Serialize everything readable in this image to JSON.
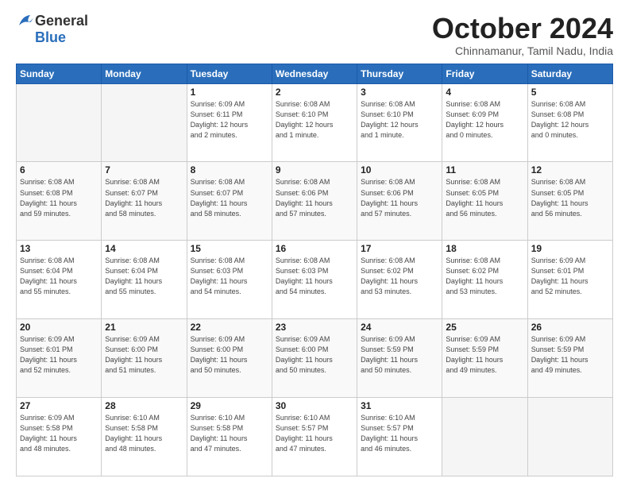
{
  "logo": {
    "line1": "General",
    "line2": "Blue"
  },
  "title": "October 2024",
  "subtitle": "Chinnamanur, Tamil Nadu, India",
  "weekdays": [
    "Sunday",
    "Monday",
    "Tuesday",
    "Wednesday",
    "Thursday",
    "Friday",
    "Saturday"
  ],
  "weeks": [
    [
      {
        "day": "",
        "info": ""
      },
      {
        "day": "",
        "info": ""
      },
      {
        "day": "1",
        "info": "Sunrise: 6:09 AM\nSunset: 6:11 PM\nDaylight: 12 hours\nand 2 minutes."
      },
      {
        "day": "2",
        "info": "Sunrise: 6:08 AM\nSunset: 6:10 PM\nDaylight: 12 hours\nand 1 minute."
      },
      {
        "day": "3",
        "info": "Sunrise: 6:08 AM\nSunset: 6:10 PM\nDaylight: 12 hours\nand 1 minute."
      },
      {
        "day": "4",
        "info": "Sunrise: 6:08 AM\nSunset: 6:09 PM\nDaylight: 12 hours\nand 0 minutes."
      },
      {
        "day": "5",
        "info": "Sunrise: 6:08 AM\nSunset: 6:08 PM\nDaylight: 12 hours\nand 0 minutes."
      }
    ],
    [
      {
        "day": "6",
        "info": "Sunrise: 6:08 AM\nSunset: 6:08 PM\nDaylight: 11 hours\nand 59 minutes."
      },
      {
        "day": "7",
        "info": "Sunrise: 6:08 AM\nSunset: 6:07 PM\nDaylight: 11 hours\nand 58 minutes."
      },
      {
        "day": "8",
        "info": "Sunrise: 6:08 AM\nSunset: 6:07 PM\nDaylight: 11 hours\nand 58 minutes."
      },
      {
        "day": "9",
        "info": "Sunrise: 6:08 AM\nSunset: 6:06 PM\nDaylight: 11 hours\nand 57 minutes."
      },
      {
        "day": "10",
        "info": "Sunrise: 6:08 AM\nSunset: 6:06 PM\nDaylight: 11 hours\nand 57 minutes."
      },
      {
        "day": "11",
        "info": "Sunrise: 6:08 AM\nSunset: 6:05 PM\nDaylight: 11 hours\nand 56 minutes."
      },
      {
        "day": "12",
        "info": "Sunrise: 6:08 AM\nSunset: 6:05 PM\nDaylight: 11 hours\nand 56 minutes."
      }
    ],
    [
      {
        "day": "13",
        "info": "Sunrise: 6:08 AM\nSunset: 6:04 PM\nDaylight: 11 hours\nand 55 minutes."
      },
      {
        "day": "14",
        "info": "Sunrise: 6:08 AM\nSunset: 6:04 PM\nDaylight: 11 hours\nand 55 minutes."
      },
      {
        "day": "15",
        "info": "Sunrise: 6:08 AM\nSunset: 6:03 PM\nDaylight: 11 hours\nand 54 minutes."
      },
      {
        "day": "16",
        "info": "Sunrise: 6:08 AM\nSunset: 6:03 PM\nDaylight: 11 hours\nand 54 minutes."
      },
      {
        "day": "17",
        "info": "Sunrise: 6:08 AM\nSunset: 6:02 PM\nDaylight: 11 hours\nand 53 minutes."
      },
      {
        "day": "18",
        "info": "Sunrise: 6:08 AM\nSunset: 6:02 PM\nDaylight: 11 hours\nand 53 minutes."
      },
      {
        "day": "19",
        "info": "Sunrise: 6:09 AM\nSunset: 6:01 PM\nDaylight: 11 hours\nand 52 minutes."
      }
    ],
    [
      {
        "day": "20",
        "info": "Sunrise: 6:09 AM\nSunset: 6:01 PM\nDaylight: 11 hours\nand 52 minutes."
      },
      {
        "day": "21",
        "info": "Sunrise: 6:09 AM\nSunset: 6:00 PM\nDaylight: 11 hours\nand 51 minutes."
      },
      {
        "day": "22",
        "info": "Sunrise: 6:09 AM\nSunset: 6:00 PM\nDaylight: 11 hours\nand 50 minutes."
      },
      {
        "day": "23",
        "info": "Sunrise: 6:09 AM\nSunset: 6:00 PM\nDaylight: 11 hours\nand 50 minutes."
      },
      {
        "day": "24",
        "info": "Sunrise: 6:09 AM\nSunset: 5:59 PM\nDaylight: 11 hours\nand 50 minutes."
      },
      {
        "day": "25",
        "info": "Sunrise: 6:09 AM\nSunset: 5:59 PM\nDaylight: 11 hours\nand 49 minutes."
      },
      {
        "day": "26",
        "info": "Sunrise: 6:09 AM\nSunset: 5:59 PM\nDaylight: 11 hours\nand 49 minutes."
      }
    ],
    [
      {
        "day": "27",
        "info": "Sunrise: 6:09 AM\nSunset: 5:58 PM\nDaylight: 11 hours\nand 48 minutes."
      },
      {
        "day": "28",
        "info": "Sunrise: 6:10 AM\nSunset: 5:58 PM\nDaylight: 11 hours\nand 48 minutes."
      },
      {
        "day": "29",
        "info": "Sunrise: 6:10 AM\nSunset: 5:58 PM\nDaylight: 11 hours\nand 47 minutes."
      },
      {
        "day": "30",
        "info": "Sunrise: 6:10 AM\nSunset: 5:57 PM\nDaylight: 11 hours\nand 47 minutes."
      },
      {
        "day": "31",
        "info": "Sunrise: 6:10 AM\nSunset: 5:57 PM\nDaylight: 11 hours\nand 46 minutes."
      },
      {
        "day": "",
        "info": ""
      },
      {
        "day": "",
        "info": ""
      }
    ]
  ]
}
